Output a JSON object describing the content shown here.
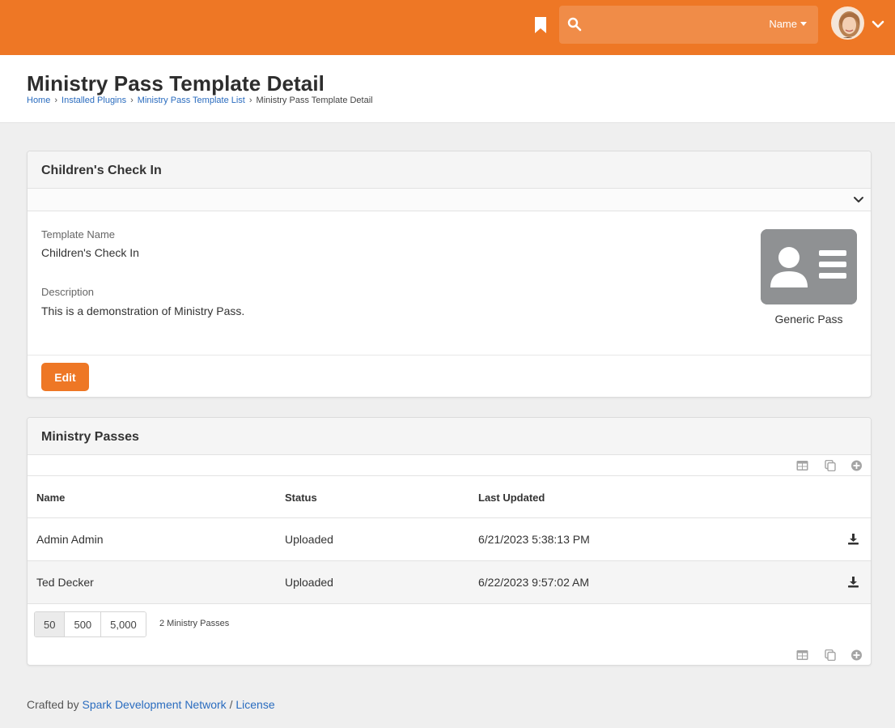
{
  "header": {
    "search_placeholder": "",
    "search_filter": "Name"
  },
  "page": {
    "title": "Ministry Pass Template Detail",
    "breadcrumb": [
      "Home",
      "Installed Plugins",
      "Ministry Pass Template List",
      "Ministry Pass Template Detail"
    ]
  },
  "template_panel": {
    "heading": "Children's Check In",
    "name_label": "Template Name",
    "name_value": "Children's Check In",
    "description_label": "Description",
    "description_value": "This is a demonstration of Ministry Pass.",
    "pass_type": "Generic Pass",
    "edit_label": "Edit",
    "pass_icon_color": "#8f9193"
  },
  "passes_panel": {
    "heading": "Ministry Passes",
    "columns": [
      "Name",
      "Status",
      "Last Updated"
    ],
    "rows": [
      {
        "name": "Admin Admin",
        "status": "Uploaded",
        "last_updated": "6/21/2023 5:38:13 PM"
      },
      {
        "name": "Ted Decker",
        "status": "Uploaded",
        "last_updated": "6/22/2023 9:57:02 AM"
      }
    ],
    "page_sizes": [
      "50",
      "500",
      "5,000"
    ],
    "row_count": "2 Ministry Passes"
  },
  "footer": {
    "crafted_by": "Crafted by",
    "network_link": "Spark Development Network",
    "separator": "/",
    "license_link": "License"
  },
  "colors": {
    "brand": "#ee7725",
    "link": "#2a6cbf"
  },
  "icons": [
    "bookmark-icon",
    "search-icon",
    "chevron-down-icon",
    "id-card-icon",
    "table-icon",
    "copy-icon",
    "add-icon",
    "download-icon"
  ]
}
